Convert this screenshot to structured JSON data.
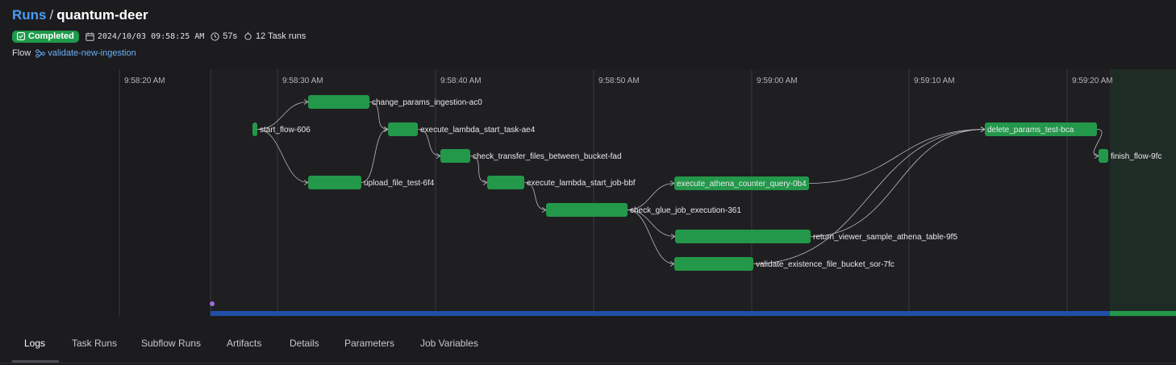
{
  "breadcrumb": {
    "parent": "Runs",
    "separator": "/",
    "current": "quantum-deer"
  },
  "status": {
    "label": "Completed",
    "color": "#1e9a4b"
  },
  "meta": {
    "datetime": "2024/10/03 09:58:25 AM",
    "duration": "57s",
    "task_runs": "12 Task runs"
  },
  "flow": {
    "label": "Flow",
    "name": "validate-new-ingestion"
  },
  "timeline": {
    "ticks": [
      "9:58:20 AM",
      "9:58:30 AM",
      "9:58:40 AM",
      "9:58:50 AM",
      "9:59:00 AM",
      "9:59:10 AM",
      "9:59:20 AM"
    ],
    "tasks": [
      "start_flow-606",
      "change_params_ingestion-ac0",
      "upload_file_test-6f4",
      "execute_lambda_start_task-ae4",
      "check_transfer_files_between_bucket-fad",
      "execute_lambda_start_job-bbf",
      "check_glue_job_execution-361",
      "execute_athena_counter_query-0b4",
      "return_viewer_sample_athena_table-9f5",
      "validate_existence_file_bucket_sor-7fc",
      "delete_params_test-bca",
      "finish_flow-9fc"
    ],
    "colors": {
      "node": "#23984a",
      "progress": "#1f4fa8",
      "progress_end": "#23984a",
      "marker": "#9b6bdc"
    }
  },
  "tabs": [
    "Logs",
    "Task Runs",
    "Subflow Runs",
    "Artifacts",
    "Details",
    "Parameters",
    "Job Variables"
  ],
  "active_tab": "Logs"
}
